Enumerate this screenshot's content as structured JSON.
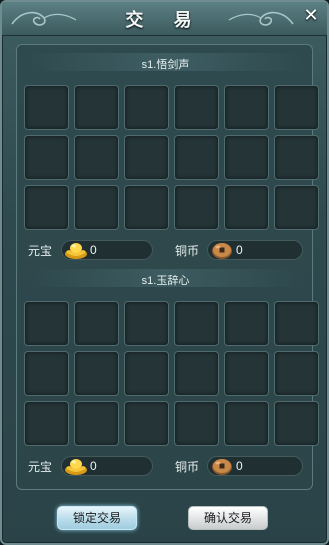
{
  "window": {
    "title": "交 易",
    "close_glyph": "✕"
  },
  "trade": {
    "player1": {
      "name": "s1.悟剑声",
      "gold_label": "元宝",
      "gold_value": "0",
      "gold_icon": "yuanbao-ingot-icon",
      "copper_label": "铜币",
      "copper_value": "0",
      "copper_icon": "copper-coin-icon",
      "slots": 18
    },
    "player2": {
      "name": "s1.玉辞心",
      "gold_label": "元宝",
      "gold_value": "0",
      "gold_icon": "yuanbao-ingot-icon",
      "copper_label": "铜币",
      "copper_value": "0",
      "copper_icon": "copper-coin-icon",
      "slots": 18
    }
  },
  "buttons": {
    "lock": "锁定交易",
    "confirm": "确认交易"
  },
  "colors": {
    "panel": "#2f4a4f",
    "slot": "#243437",
    "lock_button": "#b9dcea",
    "confirm_button": "#e1e4e5"
  }
}
